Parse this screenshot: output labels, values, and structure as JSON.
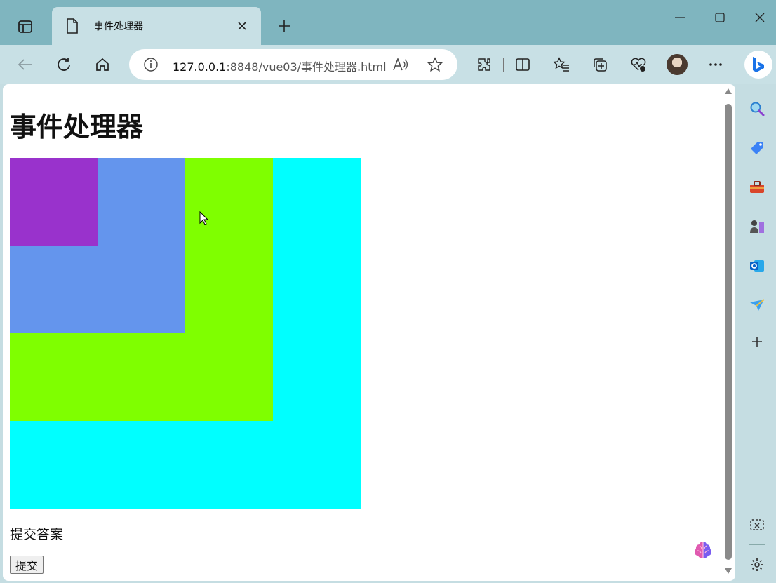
{
  "window": {
    "tab_title": "事件处理器"
  },
  "address_bar": {
    "host": "127.0.0.1",
    "path": ":8848/vue03/事件处理器.html"
  },
  "page": {
    "heading": "事件处理器",
    "boxes": [
      {
        "name": "cyan",
        "color": "#00ffff"
      },
      {
        "name": "green",
        "color": "#7fff00"
      },
      {
        "name": "blue",
        "color": "#6495ed"
      },
      {
        "name": "purple",
        "color": "#9932cc"
      }
    ],
    "submit_label": "提交答案",
    "submit_button": "提交"
  },
  "icons": {
    "toolbar": [
      "back-icon",
      "refresh-icon",
      "home-icon",
      "info-icon",
      "read-aloud-icon",
      "favorite-star-icon",
      "extensions-icon",
      "split-screen-icon",
      "favorites-icon",
      "collections-icon",
      "browser-essentials-icon",
      "profile-avatar",
      "more-icon",
      "bing-copilot-icon"
    ],
    "sidebar": [
      "search-icon",
      "shopping-tag-icon",
      "tools-icon",
      "games-icon",
      "outlook-icon",
      "drop-icon",
      "add-icon",
      "screenshot-icon",
      "settings-icon"
    ]
  }
}
